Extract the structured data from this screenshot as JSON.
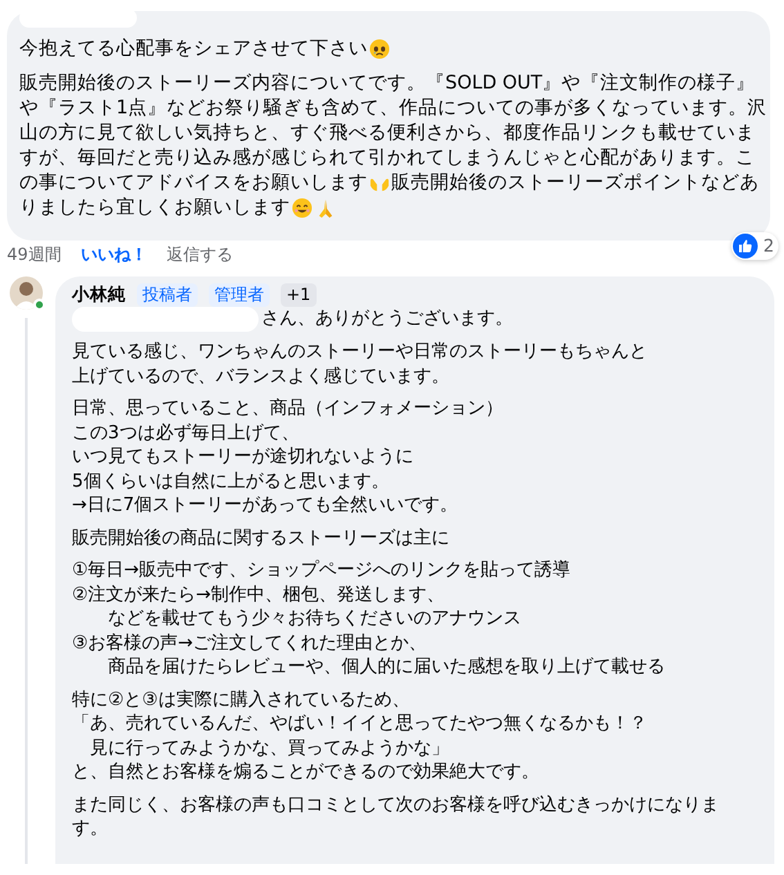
{
  "post": {
    "paragraphs": [
      [
        [
          {
            "kind": "text",
            "text": "今抱えてる心配事をシェアさせて下さい"
          },
          {
            "kind": "sad-face"
          }
        ]
      ],
      [
        [
          {
            "kind": "text",
            "text": "販売開始後のストーリーズ内容についてです。『SOLD OUT』や『注文制作の様子』"
          }
        ],
        [
          {
            "kind": "text",
            "text": "や『ラスト1点』などお祭り騒ぎも含めて、作品についての事が多くなっています。沢"
          }
        ],
        [
          {
            "kind": "text",
            "text": "山の方に見て欲しい気持ちと、すぐ飛べる便利さから、都度作品リンクも載せていま"
          }
        ],
        [
          {
            "kind": "text",
            "text": "すが、毎回だと売り込み感が感じられて引かれてしまうんじゃと心配があります。こ"
          }
        ],
        [
          {
            "kind": "text",
            "text": "の事についてアドバイスをお願いします"
          },
          {
            "kind": "open-hands"
          },
          {
            "kind": "text",
            "text": "販売開始後のストーリーズポイントなどあ"
          }
        ],
        [
          {
            "kind": "text",
            "text": "りましたら宜しくお願いします"
          },
          {
            "kind": "smile"
          },
          {
            "kind": "pray"
          }
        ]
      ]
    ],
    "time": "49週間",
    "like_label": "いいね！",
    "reply_label": "返信する",
    "liked": true,
    "reaction_count": "2"
  },
  "reply": {
    "author": "小林純",
    "online": true,
    "badges": [
      {
        "label": "投稿者",
        "kind": "role"
      },
      {
        "label": "管理者",
        "kind": "role"
      },
      {
        "label": "+1",
        "kind": "more"
      }
    ],
    "greeting": "さん、ありがとうございます。",
    "paragraphs": [
      [
        "見ている感じ、ワンちゃんのストーリーや日常のストーリーもちゃんと",
        "上げているので、バランスよく感じています。"
      ],
      [
        "日常、思っていること、商品（インフォメーション）",
        "この3つは必ず毎日上げて、",
        "いつ見てもストーリーが途切れないように",
        "5個くらいは自然に上がると思います。",
        "→日に7個ストーリーがあっても全然いいです。"
      ],
      [
        "販売開始後の商品に関するストーリーズは主に"
      ],
      [
        "①毎日→販売中です、ショップページへのリンクを貼って誘導",
        "②注文が来たら→制作中、梱包、発送します、",
        "　　などを載せてもう少々お待ちくださいのアナウンス",
        "③お客様の声→ご注文してくれた理由とか、",
        "　　商品を届けたらレビューや、個人的に届いた感想を取り上げて載せる"
      ],
      [
        "特に②と③は実際に購入されているため、",
        "「あ、売れているんだ、やばい！イイと思ってたやつ無くなるかも！？",
        "　見に行ってみようかな、買ってみようかな」",
        "と、自然とお客様を煽ることができるので効果絶大です。"
      ],
      [
        "また同じく、お客様の声も口コミとして次のお客様を呼び込むきっかけになりま",
        "す。"
      ]
    ]
  }
}
